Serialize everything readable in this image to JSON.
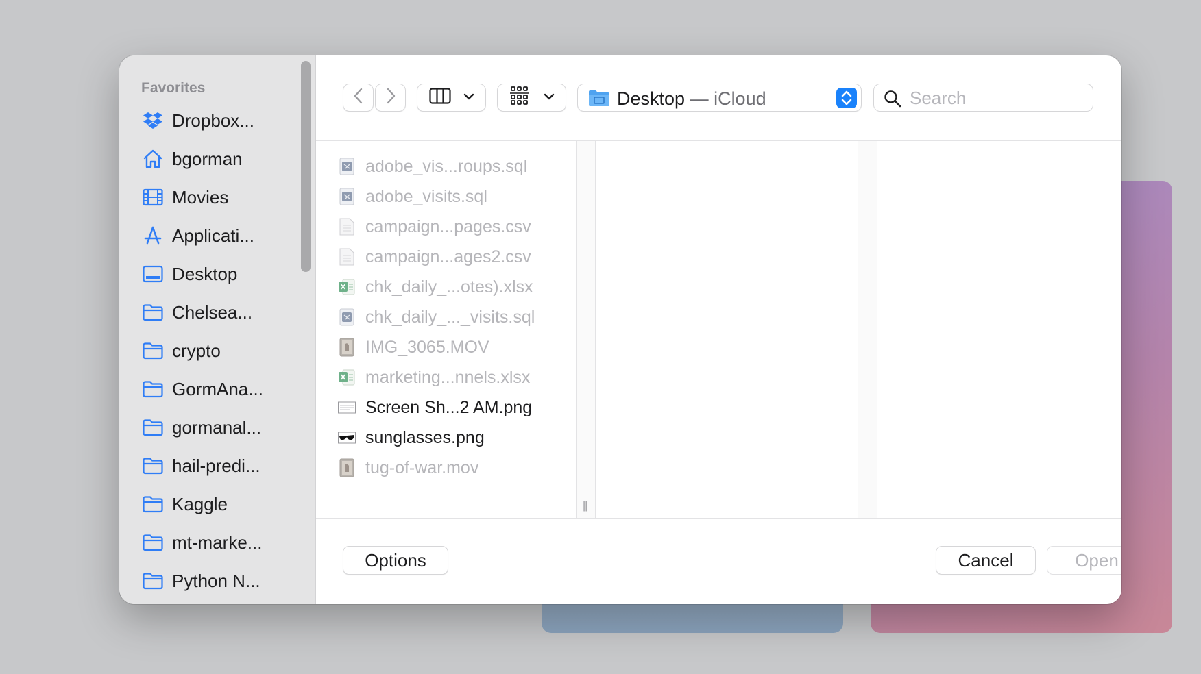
{
  "dialog": {
    "sidebar": {
      "heading": "Favorites",
      "items": [
        {
          "label": "Dropbox...",
          "icon": "dropbox-icon"
        },
        {
          "label": "bgorman",
          "icon": "home-icon"
        },
        {
          "label": "Movies",
          "icon": "film-icon"
        },
        {
          "label": "Applicati...",
          "icon": "applications-icon"
        },
        {
          "label": "Desktop",
          "icon": "desktop-icon"
        },
        {
          "label": "Chelsea...",
          "icon": "folder-icon"
        },
        {
          "label": "crypto",
          "icon": "folder-icon"
        },
        {
          "label": "GormAna...",
          "icon": "folder-icon"
        },
        {
          "label": "gormanal...",
          "icon": "folder-icon"
        },
        {
          "label": "hail-predi...",
          "icon": "folder-icon"
        },
        {
          "label": "Kaggle",
          "icon": "folder-icon"
        },
        {
          "label": "mt-marke...",
          "icon": "folder-icon"
        },
        {
          "label": "Python N...",
          "icon": "folder-icon"
        }
      ]
    },
    "toolbar": {
      "location_name": "Desktop",
      "location_suffix": " — iCloud",
      "search_placeholder": "Search"
    },
    "files": [
      {
        "name": "adobe_vis...roups.sql",
        "type": "sql",
        "enabled": false
      },
      {
        "name": "adobe_visits.sql",
        "type": "sql",
        "enabled": false
      },
      {
        "name": "campaign...pages.csv",
        "type": "csv",
        "enabled": false
      },
      {
        "name": "campaign...ages2.csv",
        "type": "csv",
        "enabled": false
      },
      {
        "name": "chk_daily_...otes).xlsx",
        "type": "xlsx",
        "enabled": false
      },
      {
        "name": "chk_daily_..._visits.sql",
        "type": "sql",
        "enabled": false
      },
      {
        "name": "IMG_3065.MOV",
        "type": "mov",
        "enabled": false
      },
      {
        "name": "marketing...nnels.xlsx",
        "type": "xlsx",
        "enabled": false
      },
      {
        "name": "Screen Sh...2 AM.png",
        "type": "png-screenshot",
        "enabled": true
      },
      {
        "name": "sunglasses.png",
        "type": "png-sunglasses",
        "enabled": true
      },
      {
        "name": "tug-of-war.mov",
        "type": "mov",
        "enabled": false
      }
    ],
    "footer": {
      "options_label": "Options",
      "cancel_label": "Cancel",
      "open_label": "Open"
    }
  },
  "colors": {
    "accent": "#1a82fb",
    "sidebar_icon": "#2f7df6",
    "disabled_text": "#b5b5b9"
  }
}
